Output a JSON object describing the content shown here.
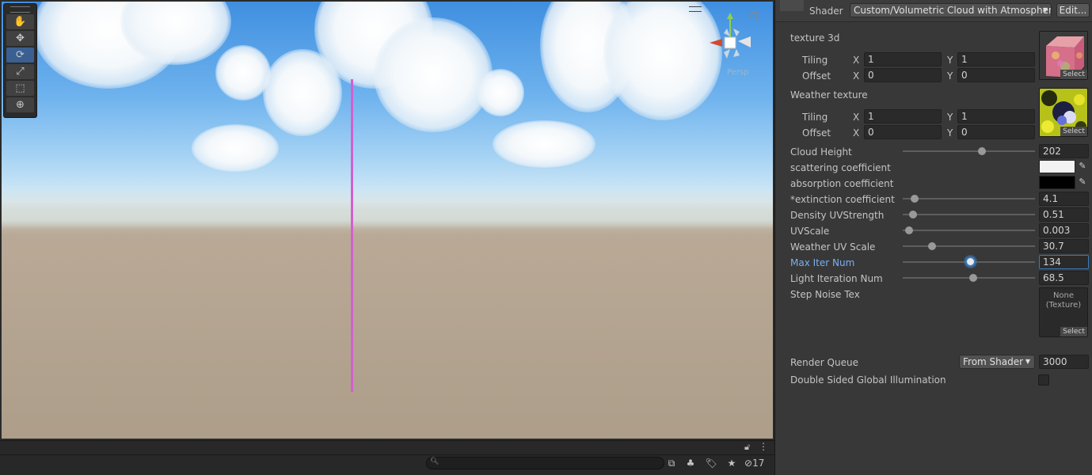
{
  "scene": {
    "tools": [
      "hand-tool",
      "move-tool",
      "rotate-tool",
      "scale-tool",
      "rect-tool",
      "transform-tool"
    ],
    "active_tool": "rotate-tool",
    "gizmo_label": "Persp"
  },
  "bottom_bar": {
    "search_placeholder": "",
    "hidden_count": "17"
  },
  "inspector": {
    "shader_label": "Shader",
    "shader_value": "Custom/Volumetric Cloud with Atmosphere",
    "edit_label": "Edit...",
    "texture3d": {
      "label": "texture 3d",
      "tiling_label": "Tiling",
      "offset_label": "Offset",
      "tiling_x": "1",
      "tiling_y": "1",
      "offset_x": "0",
      "offset_y": "0",
      "select_label": "Select"
    },
    "weather": {
      "label": "Weather texture",
      "tiling_label": "Tiling",
      "offset_label": "Offset",
      "tiling_x": "1",
      "tiling_y": "1",
      "offset_x": "0",
      "offset_y": "0",
      "select_label": "Select"
    },
    "axis_x": "X",
    "axis_y": "Y",
    "cloud_height": {
      "label": "Cloud Height",
      "value": "202",
      "fraction": 0.6
    },
    "scattering": {
      "label": "scattering coefficient",
      "color": "#f2f2f2"
    },
    "absorption": {
      "label": "absorption coefficient",
      "color": "#000000"
    },
    "extinction": {
      "label": "*extinction coefficient",
      "value": "4.1",
      "fraction": 0.09
    },
    "density": {
      "label": "Density UVStrength",
      "value": "0.51",
      "fraction": 0.08
    },
    "uvscale": {
      "label": "UVScale",
      "value": "0.003",
      "fraction": 0.05
    },
    "weather_uv": {
      "label": "Weather UV Scale",
      "value": "30.7",
      "fraction": 0.22
    },
    "max_iter": {
      "label": "Max Iter Num",
      "value": "134",
      "fraction": 0.51
    },
    "light_iter": {
      "label": "Light Iteration Num",
      "value": "68.5",
      "fraction": 0.53
    },
    "step_noise": {
      "label": "Step Noise Tex",
      "none_line1": "None",
      "none_line2": "(Texture)",
      "select_label": "Select"
    },
    "render_queue": {
      "label": "Render Queue",
      "mode": "From Shader",
      "value": "3000"
    },
    "double_sided": {
      "label": "Double Sided Global Illumination"
    }
  }
}
